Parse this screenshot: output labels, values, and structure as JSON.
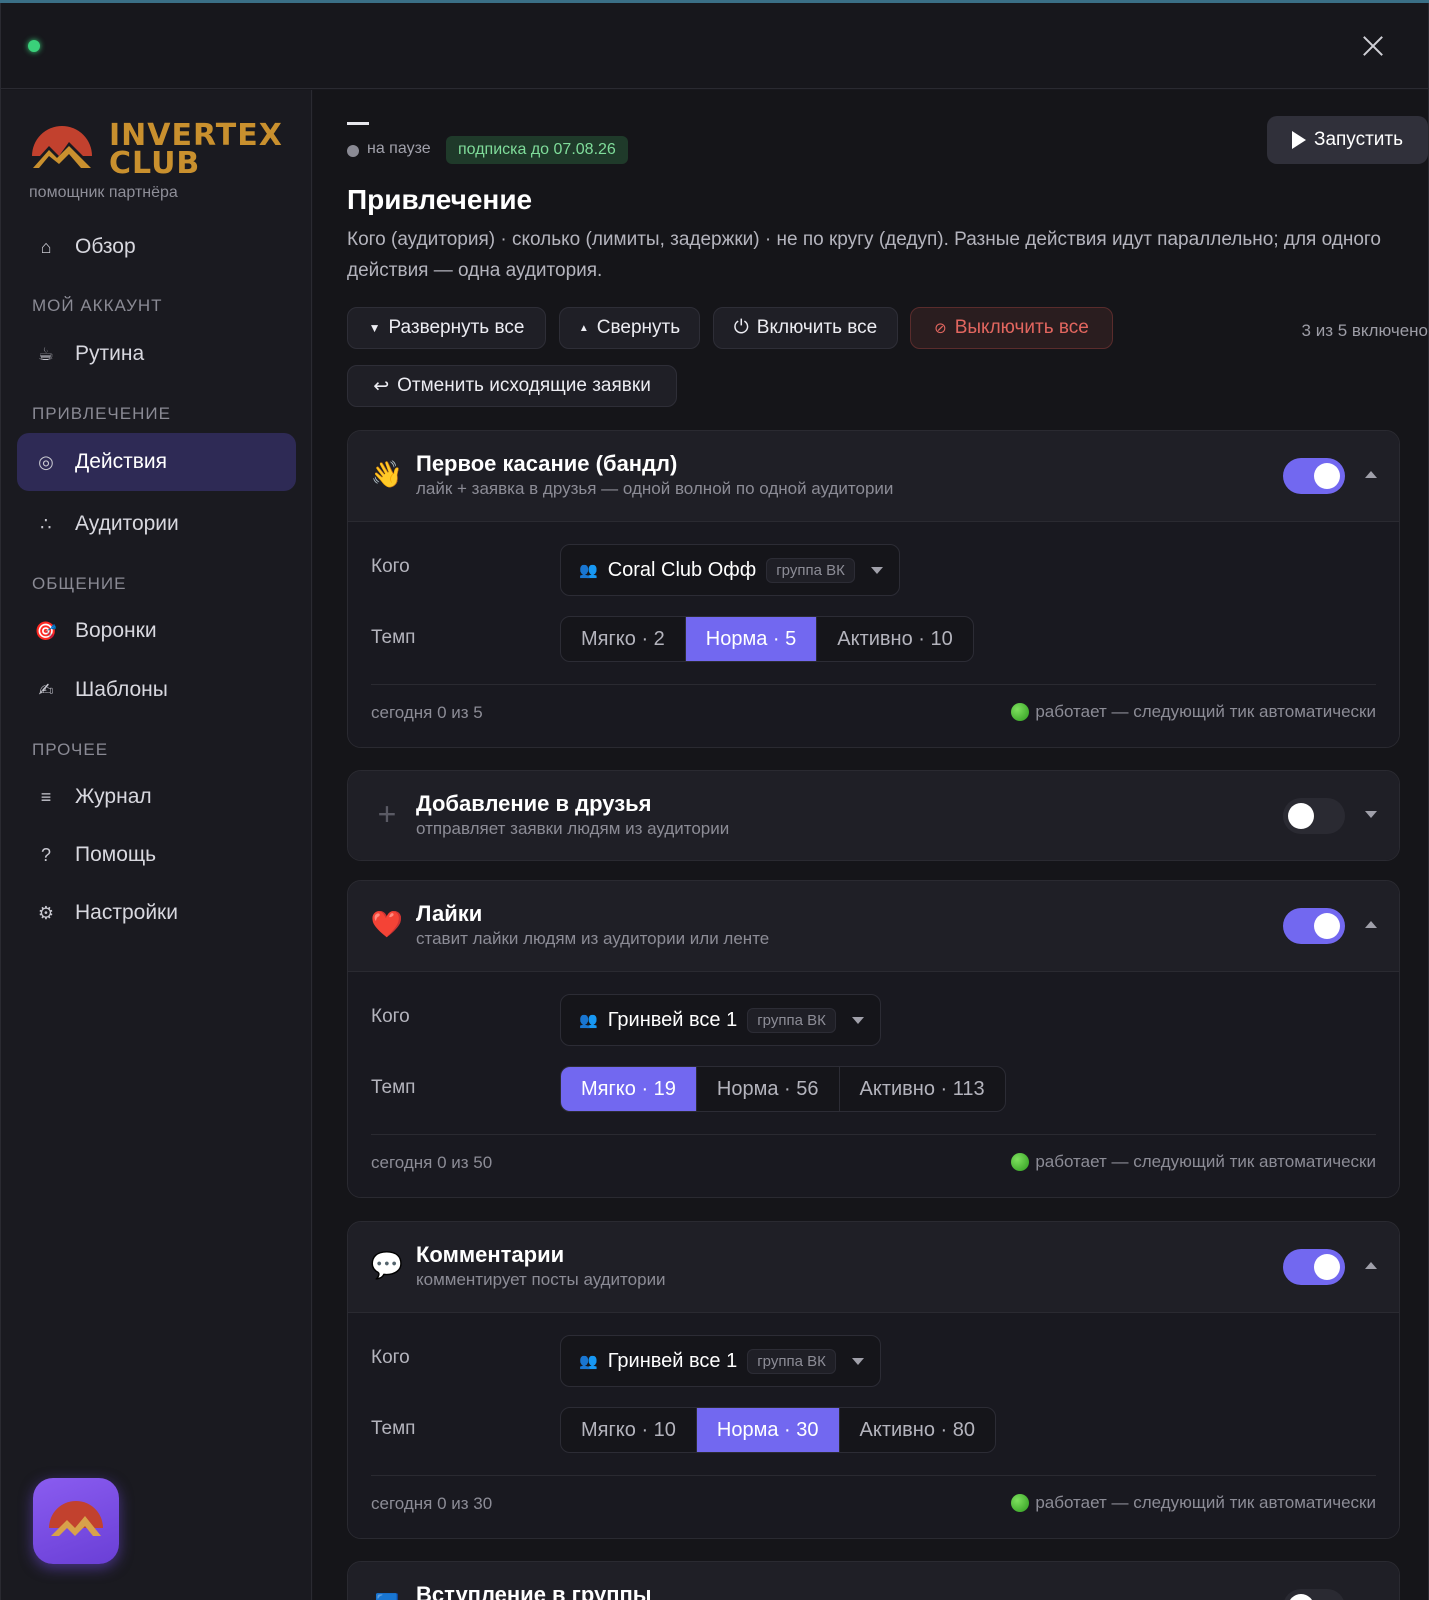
{
  "window": {
    "close_label": "×"
  },
  "sidebar": {
    "brand": {
      "line1": "INVERTEX",
      "line2": "CLUB",
      "subtitle": "помощник партнёра"
    },
    "items": [
      {
        "label": "Обзор",
        "icon": "home-icon",
        "glyph": "⌂"
      },
      {
        "section": "МОЙ АККАУНТ"
      },
      {
        "label": "Рутина",
        "icon": "coffee-icon",
        "glyph": "☕"
      },
      {
        "section": "ПРИВЛЕЧЕНИЕ"
      },
      {
        "label": "Действия",
        "icon": "target-icon",
        "glyph": "◎"
      },
      {
        "label": "Аудитории",
        "icon": "dots-icon",
        "glyph": "∴"
      },
      {
        "section": "ОБЩЕНИЕ"
      },
      {
        "label": "Воронки",
        "icon": "dart-icon",
        "glyph": "🎯"
      },
      {
        "label": "Шаблоны",
        "icon": "writing-hand-icon",
        "glyph": "✍"
      },
      {
        "section": "ПРОЧЕЕ"
      },
      {
        "label": "Журнал",
        "icon": "list-icon",
        "glyph": "≡"
      },
      {
        "label": "Помощь",
        "icon": "question-icon",
        "glyph": "?"
      },
      {
        "label": "Настройки",
        "icon": "gear-icon",
        "glyph": "⚙"
      }
    ]
  },
  "header": {
    "status": "на паузе",
    "subscription": "подписка до 07.08.26",
    "run_label": "Запустить",
    "title": "Привлечение",
    "description": "Кого (аудитория) · сколько (лимиты, задержки) · не по кругу (дедуп). Разные действия идут параллельно; для одного действия — одна аудитория."
  },
  "toolbar": {
    "expand_all": "Развернуть все",
    "collapse": "Свернуть",
    "enable_all": "Включить все",
    "disable_all": "Выключить все",
    "cancel_requests": "Отменить исходящие заявки",
    "enabled_count": "3 из 5 включено"
  },
  "labels": {
    "who": "Кого",
    "pace": "Темп",
    "working": "работает — следующий тик автоматически",
    "group_tag": "группа ВК"
  },
  "cards": [
    {
      "title": "Первое касание (бандл)",
      "subtitle": "лайк + заявка в друзья — одной волной по одной аудитории",
      "emoji": "👋",
      "enabled": true,
      "expanded": true,
      "audience": "Coral Club Офф",
      "pace": [
        "Мягко · 2",
        "Норма · 5",
        "Активно · 10"
      ],
      "pace_selected": 1,
      "today": "сегодня 0 из 5"
    },
    {
      "title": "Добавление в друзья",
      "subtitle": "отправляет заявки людям из аудитории",
      "emoji": "+",
      "enabled": false,
      "expanded": false
    },
    {
      "title": "Лайки",
      "subtitle": "ставит лайки людям из аудитории или ленте",
      "emoji": "❤️",
      "enabled": true,
      "expanded": true,
      "audience": "Гринвей все 1",
      "pace": [
        "Мягко · 19",
        "Норма · 56",
        "Активно · 113"
      ],
      "pace_selected": 0,
      "today": "сегодня 0 из 50"
    },
    {
      "title": "Комментарии",
      "subtitle": "комментирует посты аудитории",
      "emoji": "💬",
      "enabled": true,
      "expanded": true,
      "audience": "Гринвей все 1",
      "pace": [
        "Мягко · 10",
        "Норма · 30",
        "Активно · 80"
      ],
      "pace_selected": 1,
      "today": "сегодня 0 из 30"
    },
    {
      "title": "Вступление в группы",
      "emoji": "🟦",
      "enabled": false,
      "expanded": false
    }
  ],
  "colors": {
    "accent": "#7268f0",
    "brand": "#c9902e",
    "ok": "#3ad07a",
    "danger": "#e2665f"
  }
}
